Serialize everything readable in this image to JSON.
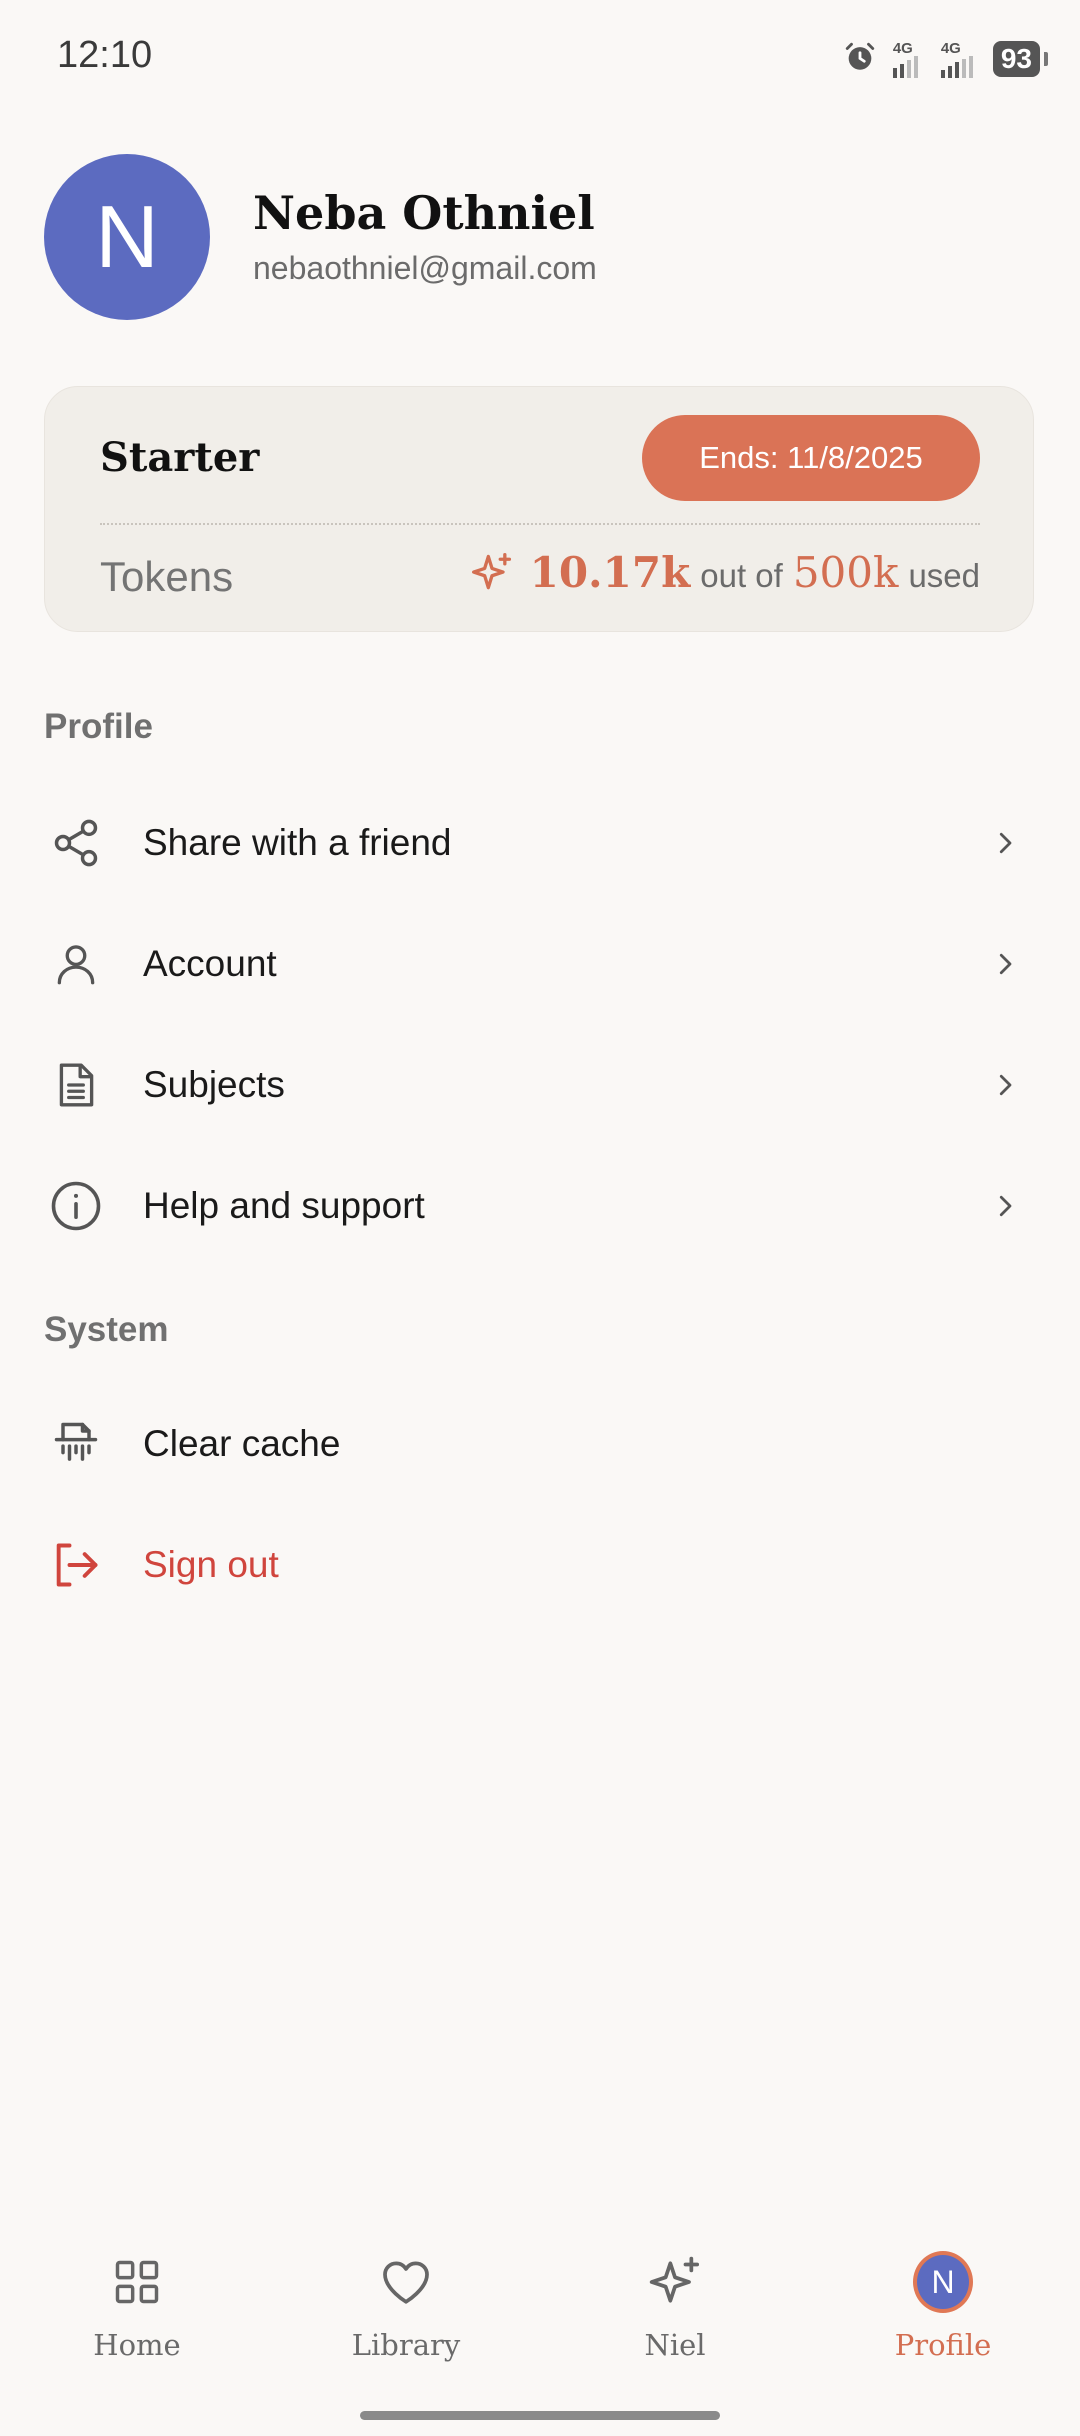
{
  "status_bar": {
    "time": "12:10",
    "network_1": "4G",
    "network_2": "4G",
    "battery": "93"
  },
  "profile": {
    "avatar_initial": "N",
    "name": "Neba Othniel",
    "email": "nebaothniel@gmail.com"
  },
  "plan": {
    "name": "Starter",
    "ends": "Ends: 11/8/2025",
    "tokens_label": "Tokens",
    "tokens_used": "10.17k",
    "out_of_text": "out of",
    "tokens_total": "500k",
    "used_text": "used"
  },
  "sections": {
    "profile_title": "Profile",
    "system_title": "System"
  },
  "menu": {
    "share": "Share with a friend",
    "account": "Account",
    "subjects": "Subjects",
    "help": "Help and support",
    "clear_cache": "Clear cache",
    "sign_out": "Sign out"
  },
  "bottom_nav": {
    "home": "Home",
    "library": "Library",
    "niel": "Niel",
    "profile": "Profile",
    "avatar_initial": "N"
  },
  "colors": {
    "accent": "#da7356",
    "avatar": "#5c6bc0",
    "danger": "#d0453d",
    "background": "#faf8f6"
  }
}
